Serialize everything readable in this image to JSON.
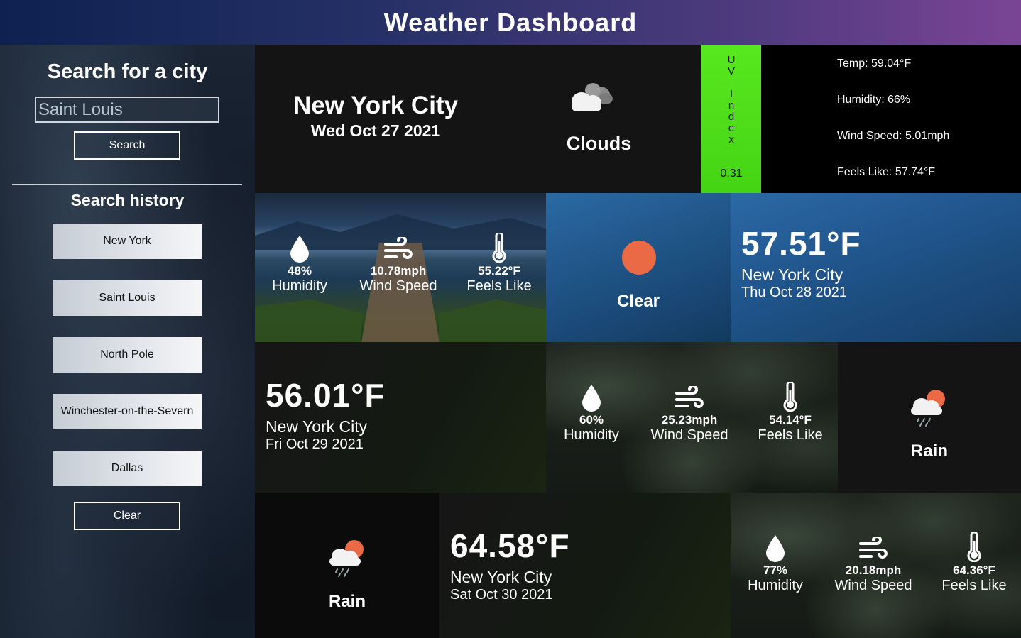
{
  "header": {
    "title": "Weather Dashboard"
  },
  "sidebar": {
    "search_title": "Search for a city",
    "search_value": "Saint Louis",
    "search_button": "Search",
    "history_title": "Search history",
    "history": [
      "New York",
      "Saint Louis",
      "North Pole",
      "Winchester-on-the-Severn",
      "Dallas"
    ],
    "clear_button": "Clear"
  },
  "current": {
    "city": "New York City",
    "date": "Wed Oct 27 2021",
    "condition": "Clouds",
    "uv_label": "UV Index",
    "uv_value": "0.31",
    "temp": "Temp: 59.04°F",
    "humidity": "Humidity: 66%",
    "wind": "Wind Speed: 5.01mph",
    "feels": "Feels Like: 57.74°F"
  },
  "forecast": [
    {
      "humidity": "48%",
      "wind": "10.78mph",
      "feels": "55.22°F",
      "condition": "Clear",
      "temp": "57.51°F",
      "city": "New York City",
      "date": "Thu Oct 28 2021"
    },
    {
      "temp": "56.01°F",
      "city": "New York City",
      "date": "Fri Oct 29 2021",
      "humidity": "60%",
      "wind": "25.23mph",
      "feels": "54.14°F",
      "condition": "Rain"
    },
    {
      "condition": "Rain",
      "temp": "64.58°F",
      "city": "New York City",
      "date": "Sat Oct 30 2021",
      "humidity": "77%",
      "wind": "20.18mph",
      "feels": "64.36°F"
    }
  ],
  "labels": {
    "humidity": "Humidity",
    "wind": "Wind Speed",
    "feels": "Feels Like"
  },
  "colors": {
    "uv": "#4cdc18",
    "sun": "#ea6a45",
    "accent_blue": "#1f5288"
  }
}
